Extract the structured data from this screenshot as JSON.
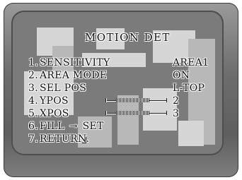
{
  "menu": {
    "title": "MOTION DET",
    "items": [
      {
        "num": "1.",
        "label": "SENSITIVITY",
        "value": "AREA1"
      },
      {
        "num": "2.",
        "label": "AREA MODE",
        "value": "ON"
      },
      {
        "num": "3.",
        "label": "SEL POS",
        "value": "L-TOP"
      },
      {
        "num": "4.",
        "label": "YPOS",
        "value": "2",
        "level": 0.5
      },
      {
        "num": "5.",
        "label": "XPOS",
        "value": "3",
        "level": 0.5
      },
      {
        "num": "6.",
        "label": "FILL",
        "arrow": "→",
        "action": "SET"
      },
      {
        "num": "7.",
        "label": "RETURN."
      }
    ]
  },
  "colors": {
    "bezel": "#6e6e6e",
    "screen": "#7b7b7b",
    "osd_text": "#111111",
    "osd_outline": "#ffffff"
  }
}
